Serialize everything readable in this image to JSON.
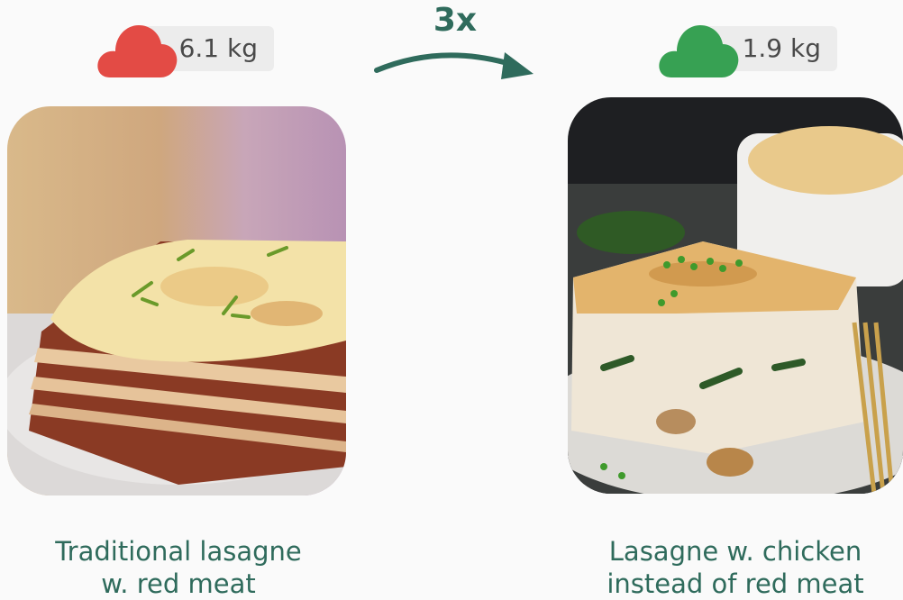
{
  "left": {
    "emission_label": "6.1 kg",
    "cloud_color": "#e34b45",
    "cloud_icon": "red-cloud-icon",
    "caption_line1": "Traditional lasagne",
    "caption_line2": "w. red meat"
  },
  "right": {
    "emission_label": "1.9 kg",
    "cloud_color": "#37a153",
    "cloud_icon": "green-cloud-icon",
    "caption_line1": "Lasagne w. chicken",
    "caption_line2": "instead of red meat"
  },
  "comparison": {
    "multiplier": "3x",
    "arrow_color": "#2f6b5c"
  }
}
